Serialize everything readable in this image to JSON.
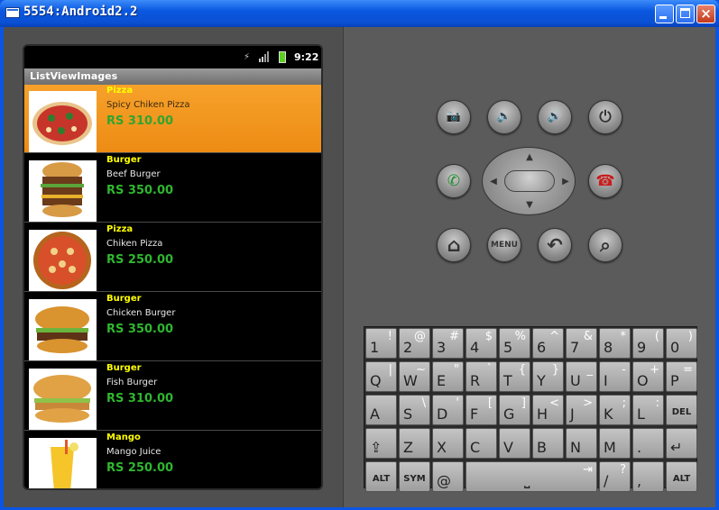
{
  "window": {
    "title": "5554:Android2.2",
    "close_glyph": "×"
  },
  "status_bar": {
    "time": "9:22",
    "usb_glyph": "⚡",
    "signal_icon": "signal-icon",
    "battery_icon": "battery-charging-icon"
  },
  "app": {
    "title": "ListViewImages"
  },
  "items": [
    {
      "category": "Pizza",
      "name": "Spicy Chiken Pizza",
      "price": "RS 310.00",
      "selected": true,
      "image": "pizza-image"
    },
    {
      "category": "Burger",
      "name": "Beef Burger",
      "price": "RS 350.00",
      "selected": false,
      "image": "burger-image"
    },
    {
      "category": "Pizza",
      "name": "Chiken Pizza",
      "price": "RS 250.00",
      "selected": false,
      "image": "pizza-image"
    },
    {
      "category": "Burger",
      "name": "Chicken Burger",
      "price": "RS 350.00",
      "selected": false,
      "image": "burger-image"
    },
    {
      "category": "Burger",
      "name": "Fish Burger",
      "price": "RS 310.00",
      "selected": false,
      "image": "burger-image"
    },
    {
      "category": "Mango",
      "name": "Mango Juice",
      "price": "RS 250.00",
      "selected": false,
      "image": "juice-image"
    }
  ],
  "controls": {
    "camera_glyph": "📷",
    "vol_down_glyph": "🔈",
    "vol_up_glyph": "🔊",
    "power_glyph": "⏻",
    "call_glyph": "✆",
    "end_call_glyph": "☎",
    "home_glyph": "⌂",
    "menu_label": "MENU",
    "back_glyph": "↶",
    "search_glyph": "⌕",
    "dpad_up": "▲",
    "dpad_down": "▼",
    "dpad_left": "◀",
    "dpad_right": "▶"
  },
  "keyboard": {
    "rows": [
      [
        {
          "m": "1",
          "s": "!"
        },
        {
          "m": "2",
          "s": "@"
        },
        {
          "m": "3",
          "s": "#"
        },
        {
          "m": "4",
          "s": "$"
        },
        {
          "m": "5",
          "s": "%"
        },
        {
          "m": "6",
          "s": "^"
        },
        {
          "m": "7",
          "s": "&"
        },
        {
          "m": "8",
          "s": "*"
        },
        {
          "m": "9",
          "s": "("
        },
        {
          "m": "0",
          "s": ")"
        }
      ],
      [
        {
          "m": "Q",
          "s": "|"
        },
        {
          "m": "W",
          "s": "~"
        },
        {
          "m": "E",
          "s": "\""
        },
        {
          "m": "R",
          "s": "`"
        },
        {
          "m": "T",
          "s": "{"
        },
        {
          "m": "Y",
          "s": "}"
        },
        {
          "m": "U",
          "s": "_"
        },
        {
          "m": "I",
          "s": "-"
        },
        {
          "m": "O",
          "s": "+"
        },
        {
          "m": "P",
          "s": "="
        }
      ],
      [
        {
          "m": "A",
          "s": ""
        },
        {
          "m": "S",
          "s": "\\"
        },
        {
          "m": "D",
          "s": "'"
        },
        {
          "m": "F",
          "s": "["
        },
        {
          "m": "G",
          "s": "]"
        },
        {
          "m": "H",
          "s": "<"
        },
        {
          "m": "J",
          "s": ">"
        },
        {
          "m": "K",
          "s": ";"
        },
        {
          "m": "L",
          "s": ":"
        },
        {
          "m": "DEL",
          "s": ""
        }
      ],
      [
        {
          "m": "⇪",
          "s": ""
        },
        {
          "m": "Z",
          "s": ""
        },
        {
          "m": "X",
          "s": ""
        },
        {
          "m": "C",
          "s": ""
        },
        {
          "m": "V",
          "s": ""
        },
        {
          "m": "B",
          "s": ""
        },
        {
          "m": "N",
          "s": ""
        },
        {
          "m": "M",
          "s": ""
        },
        {
          "m": ".",
          "s": ""
        },
        {
          "m": "↵",
          "s": ""
        }
      ]
    ],
    "bottom": {
      "alt_left": "ALT",
      "sym": "SYM",
      "at": "@",
      "space": "⎵",
      "tab": "⇥",
      "slash": "/",
      "question": "?",
      "comma": ",",
      "alt_right": "ALT"
    }
  }
}
